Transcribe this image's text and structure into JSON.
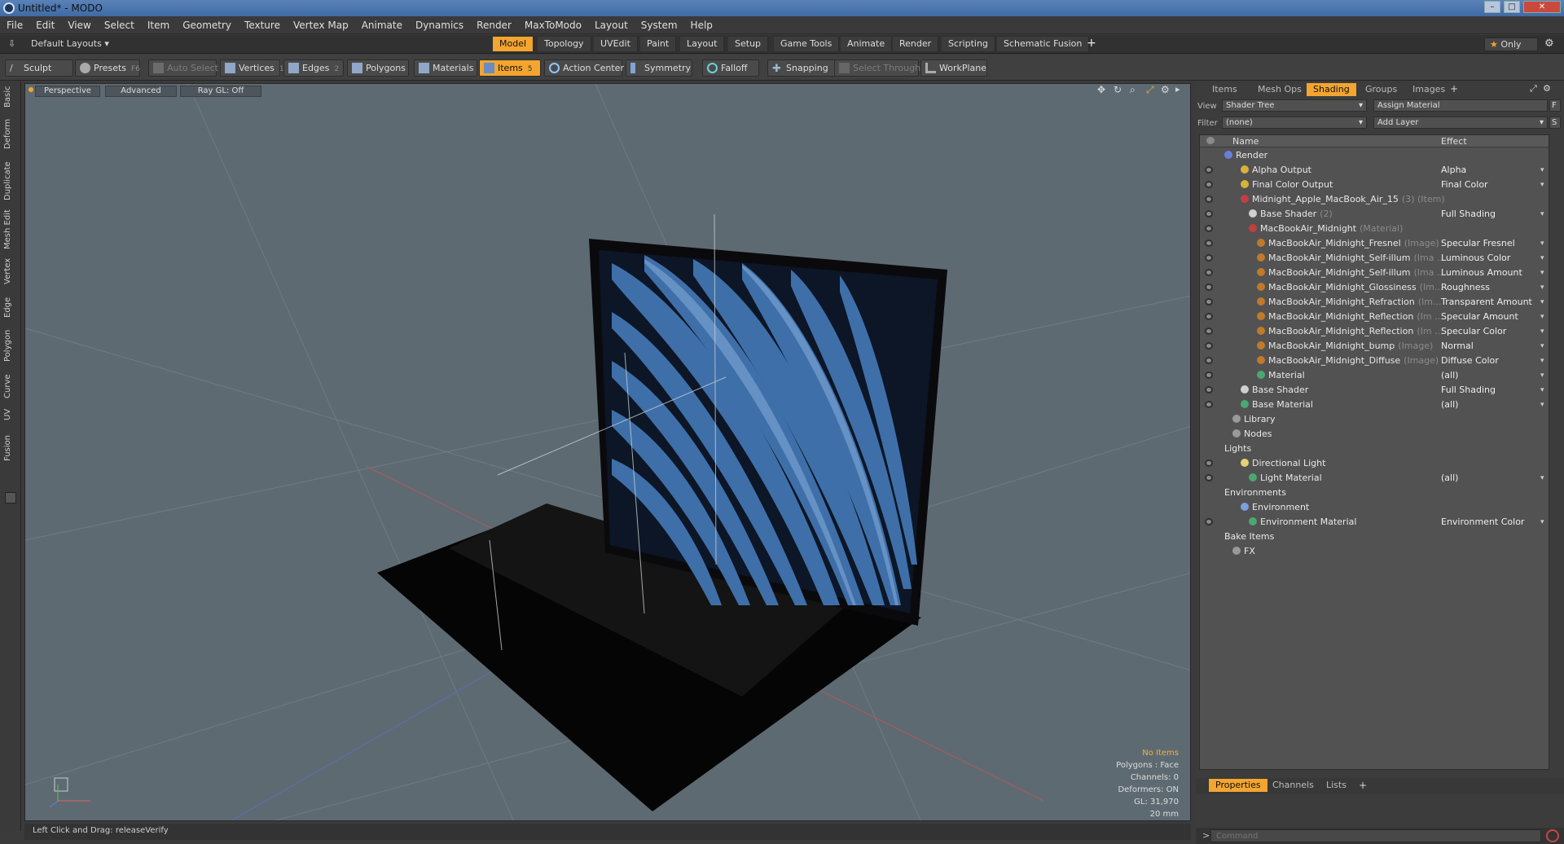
{
  "window": {
    "title": "Untitled* - MODO"
  },
  "menu": [
    "File",
    "Edit",
    "View",
    "Select",
    "Item",
    "Geometry",
    "Texture",
    "Vertex Map",
    "Animate",
    "Dynamics",
    "Render",
    "MaxToModo",
    "Layout",
    "System",
    "Help"
  ],
  "layoutbar": {
    "layouts": "Default Layouts",
    "tabs": [
      "Model",
      "Topology",
      "UVEdit",
      "Paint",
      "Layout",
      "Setup",
      "Game Tools",
      "Animate",
      "Render",
      "Scripting",
      "Schematic Fusion"
    ],
    "active_tab": "Model",
    "only": "Only"
  },
  "toolbar": {
    "sculpt": "Sculpt",
    "presets": "Presets",
    "presets_key": "F6",
    "auto_select": "Auto Select",
    "vertices": "Vertices",
    "vertices_key": "1",
    "edges": "Edges",
    "edges_key": "2",
    "polygons": "Polygons",
    "materials": "Materials",
    "items": "Items",
    "items_key": "5",
    "action_center": "Action Center",
    "symmetry": "Symmetry",
    "falloff": "Falloff",
    "snapping": "Snapping",
    "select_through": "Select Through",
    "workplane": "WorkPlane"
  },
  "lefttabs": [
    "Basic",
    "Deform",
    "Duplicate",
    "Mesh Edit",
    "Vertex",
    "Edge",
    "Polygon",
    "Curve",
    "UV",
    "Fusion"
  ],
  "viewport": {
    "perspective": "Perspective",
    "advanced": "Advanced",
    "raygl": "Ray GL: Off",
    "no_items": "No Items",
    "polygons": "Polygons : Face",
    "channels": "Channels: 0",
    "deformers": "Deformers: ON",
    "gl": "GL: 31,970",
    "scale": "20 mm"
  },
  "status": {
    "text": "Left Click and Drag:  releaseVerify"
  },
  "rightpanel": {
    "tabs": [
      "Items",
      "Mesh Ops",
      "Shading",
      "Groups",
      "Images"
    ],
    "active_tab": "Shading",
    "view_label": "View",
    "view_value": "Shader Tree",
    "assign": "Assign Material",
    "filter_label": "Filter",
    "filter_value": "(none)",
    "add_layer": "Add Layer",
    "col_name": "Name",
    "col_effect": "Effect",
    "rows": [
      {
        "name": "Render",
        "sub": "",
        "effect": "",
        "indent": 0,
        "color": "#6b7fd8",
        "eye": false
      },
      {
        "name": "Alpha Output",
        "sub": "",
        "effect": "Alpha",
        "indent": 2,
        "color": "#d8b238",
        "eye": true
      },
      {
        "name": "Final Color Output",
        "sub": "",
        "effect": "Final Color",
        "indent": 2,
        "color": "#d8b238",
        "eye": true
      },
      {
        "name": "Midnight_Apple_MacBook_Air_15",
        "sub": "(3) (Item)",
        "effect": "",
        "indent": 2,
        "color": "#c04040",
        "eye": true
      },
      {
        "name": "Base Shader",
        "sub": "(2)",
        "effect": "Full Shading",
        "indent": 3,
        "color": "#cfcfcf",
        "eye": true
      },
      {
        "name": "MacBookAir_Midnight",
        "sub": "(Material)",
        "effect": "",
        "indent": 3,
        "color": "#c04040",
        "eye": true
      },
      {
        "name": "MacBookAir_Midnight_Fresnel",
        "sub": "(Image)",
        "effect": "Specular Fresnel",
        "indent": 4,
        "color": "#c07a2a",
        "eye": true
      },
      {
        "name": "MacBookAir_Midnight_Self-illum",
        "sub": "(Ima ...",
        "effect": "Luminous Color",
        "indent": 4,
        "color": "#c07a2a",
        "eye": true
      },
      {
        "name": "MacBookAir_Midnight_Self-illum",
        "sub": "(Ima ...",
        "effect": "Luminous Amount",
        "indent": 4,
        "color": "#c07a2a",
        "eye": true
      },
      {
        "name": "MacBookAir_Midnight_Glossiness",
        "sub": "(Im...",
        "effect": "Roughness",
        "indent": 4,
        "color": "#c07a2a",
        "eye": true
      },
      {
        "name": "MacBookAir_Midnight_Refraction",
        "sub": "(Im...",
        "effect": "Transparent Amount",
        "indent": 4,
        "color": "#c07a2a",
        "eye": true
      },
      {
        "name": "MacBookAir_Midnight_Reflection",
        "sub": "(Im ...",
        "effect": "Specular Amount",
        "indent": 4,
        "color": "#c07a2a",
        "eye": true
      },
      {
        "name": "MacBookAir_Midnight_Reflection",
        "sub": "(Im ...",
        "effect": "Specular Color",
        "indent": 4,
        "color": "#c07a2a",
        "eye": true
      },
      {
        "name": "MacBookAir_Midnight_bump",
        "sub": "(Image)",
        "effect": "Normal",
        "indent": 4,
        "color": "#c07a2a",
        "eye": true
      },
      {
        "name": "MacBookAir_Midnight_Diffuse",
        "sub": "(Image)",
        "effect": "Diffuse Color",
        "indent": 4,
        "color": "#c07a2a",
        "eye": true
      },
      {
        "name": "Material",
        "sub": "",
        "effect": "(all)",
        "indent": 4,
        "color": "#4aa870",
        "eye": true
      },
      {
        "name": "Base Shader",
        "sub": "",
        "effect": "Full Shading",
        "indent": 2,
        "color": "#cfcfcf",
        "eye": true
      },
      {
        "name": "Base Material",
        "sub": "",
        "effect": "(all)",
        "indent": 2,
        "color": "#4aa870",
        "eye": true
      },
      {
        "name": "Library",
        "sub": "",
        "effect": "",
        "indent": 1,
        "color": "#999999",
        "eye": false
      },
      {
        "name": "Nodes",
        "sub": "",
        "effect": "",
        "indent": 1,
        "color": "#999999",
        "eye": false
      },
      {
        "name": "Lights",
        "sub": "",
        "effect": "",
        "indent": 0,
        "color": "",
        "eye": false
      },
      {
        "name": "Directional Light",
        "sub": "",
        "effect": "",
        "indent": 2,
        "color": "#e8d070",
        "eye": true
      },
      {
        "name": "Light Material",
        "sub": "",
        "effect": "(all)",
        "indent": 3,
        "color": "#4aa870",
        "eye": true
      },
      {
        "name": "Environments",
        "sub": "",
        "effect": "",
        "indent": 0,
        "color": "",
        "eye": false
      },
      {
        "name": "Environment",
        "sub": "",
        "effect": "",
        "indent": 2,
        "color": "#7aa0e0",
        "eye": false
      },
      {
        "name": "Environment Material",
        "sub": "",
        "effect": "Environment Color",
        "indent": 3,
        "color": "#4aa870",
        "eye": true
      },
      {
        "name": "Bake Items",
        "sub": "",
        "effect": "",
        "indent": 0,
        "color": "",
        "eye": false
      },
      {
        "name": "FX",
        "sub": "",
        "effect": "",
        "indent": 1,
        "color": "#999999",
        "eye": false
      }
    ],
    "bottom_tabs": [
      "Properties",
      "Channels",
      "Lists"
    ],
    "bottom_active": "Properties",
    "command_placeholder": "Command"
  }
}
